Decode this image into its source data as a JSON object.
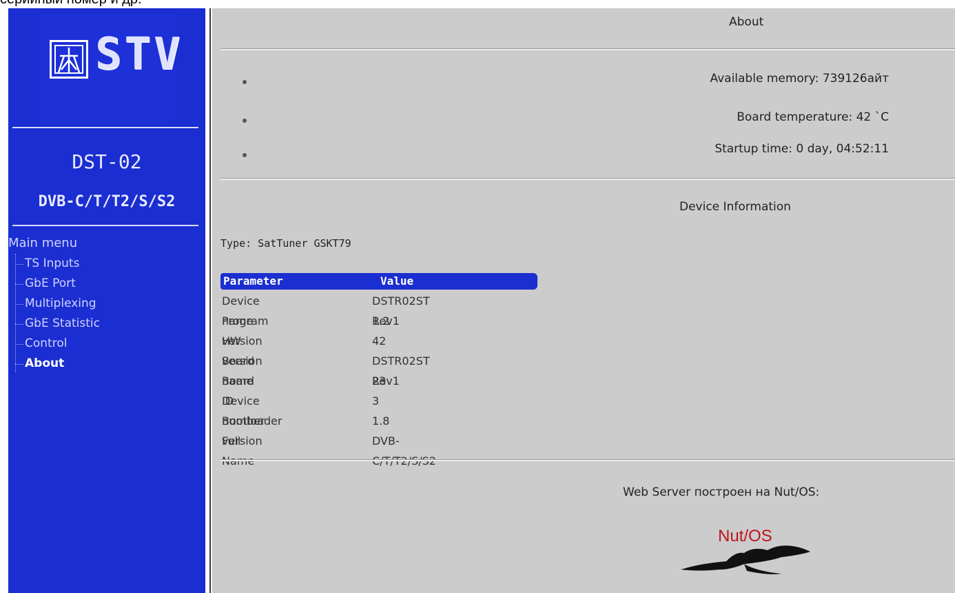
{
  "top_cut_text": "серийный номер и др.",
  "sidebar": {
    "logo_text": "STV",
    "model_name": "DST-02",
    "model_standards": "DVB-C/T/T2/S/S2",
    "menu_title": "Main menu",
    "items": [
      {
        "label": "TS Inputs"
      },
      {
        "label": "GbE Port"
      },
      {
        "label": "Multiplexing"
      },
      {
        "label": "GbE Statistic"
      },
      {
        "label": "Control"
      },
      {
        "label": "About",
        "active": true
      }
    ]
  },
  "main": {
    "title": "About",
    "status": [
      "Available memory: 739126айт",
      "Board temperature: 42 `C",
      "Startup time: 0 day, 04:52:11"
    ],
    "device_info_title": "Device Information",
    "type_line": "Type: SatTuner GSKT79",
    "table": {
      "headers": [
        "Parameter",
        "Value"
      ],
      "rows": [
        [
          "Device name",
          "DSTR02ST Rev1"
        ],
        [
          "Program version",
          "1.2"
        ],
        [
          "HW version",
          "42"
        ],
        [
          "Board name",
          "DSTR02ST Rev1"
        ],
        [
          "Board ID",
          "23"
        ],
        [
          "Device number",
          "3"
        ],
        [
          "Bootloader version",
          "1.8"
        ],
        [
          "Full Name",
          "DVB-C/T/T2/S/S2"
        ]
      ]
    },
    "footer_text": "Web Server построен на Nut/OS:",
    "footer_logo_text": "Nut/OS"
  },
  "colors": {
    "sidebar_bg": "#1b2ed1",
    "main_bg": "#cccccc",
    "header_bg": "#1b2ed1",
    "nutos_red": "#c0141c"
  }
}
